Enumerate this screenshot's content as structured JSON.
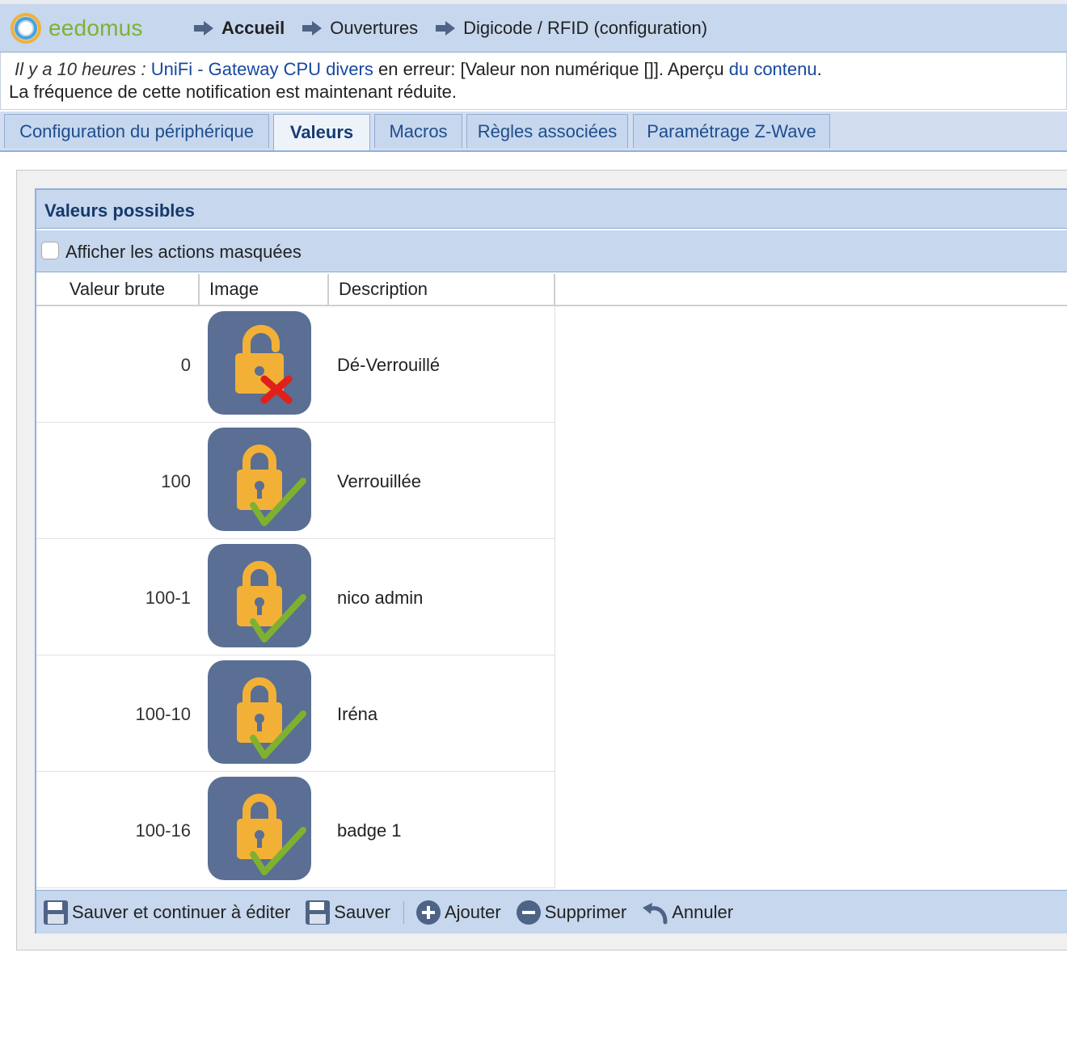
{
  "app": {
    "logo_text": "eedomus"
  },
  "breadcrumb": [
    {
      "label": "Accueil",
      "bold": true
    },
    {
      "label": "Ouvertures",
      "bold": false
    },
    {
      "label": "Digicode / RFID (configuration)",
      "bold": false
    }
  ],
  "notification": {
    "time": "Il y a 10 heures :",
    "link1": "UniFi - Gateway CPU divers",
    "text1": "en erreur: [Valeur non numérique []]. Aperçu",
    "link2": "du contenu",
    "dot": ".",
    "line2": "La fréquence de cette notification est maintenant réduite."
  },
  "tabs": [
    {
      "label": "Configuration du périphérique",
      "active": false
    },
    {
      "label": "Valeurs",
      "active": true
    },
    {
      "label": "Macros",
      "active": false
    },
    {
      "label": "Règles associées",
      "active": false
    },
    {
      "label": "Paramétrage Z-Wave",
      "active": false
    }
  ],
  "panel": {
    "title": "Valeurs possibles",
    "show_hidden_label": "Afficher les actions masquées",
    "show_hidden_checked": false
  },
  "table": {
    "headers": [
      "Valeur brute",
      "Image",
      "Description"
    ],
    "rows": [
      {
        "value": "0",
        "icon": "unlocked-padlock-red-cross-icon",
        "description": "Dé-Verrouillé"
      },
      {
        "value": "100",
        "icon": "locked-padlock-green-check-icon",
        "description": "Verrouillée"
      },
      {
        "value": "100-1",
        "icon": "locked-padlock-green-check-icon",
        "description": "nico admin"
      },
      {
        "value": "100-10",
        "icon": "locked-padlock-green-check-icon",
        "description": "Iréna"
      },
      {
        "value": "100-16",
        "icon": "locked-padlock-green-check-icon",
        "description": "badge 1"
      }
    ]
  },
  "toolbar": {
    "save_continue": "Sauver et continuer à éditer",
    "save": "Sauver",
    "add": "Ajouter",
    "delete": "Supprimer",
    "cancel": "Annuler"
  },
  "colors": {
    "header_bg": "#c6d7ee",
    "icon_tile": "#5a6f93",
    "padlock": "#f2b136",
    "check": "#7fb131",
    "cross": "#e0201b",
    "link": "#16489e"
  }
}
